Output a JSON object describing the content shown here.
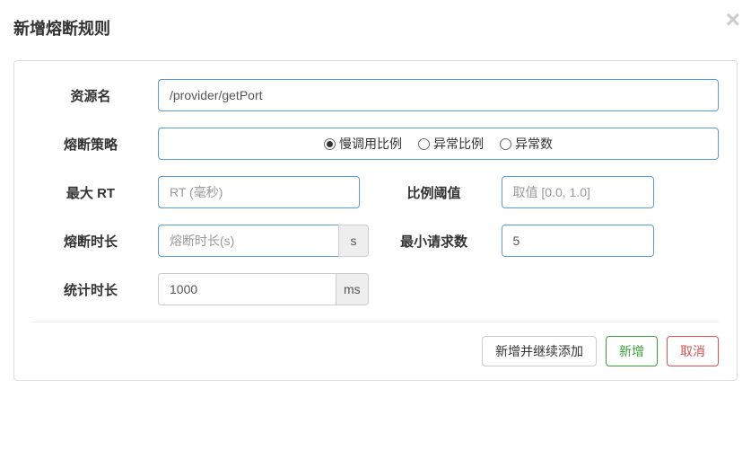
{
  "modal": {
    "title": "新增熔断规则"
  },
  "form": {
    "resource": {
      "label": "资源名",
      "value": "/provider/getPort"
    },
    "strategy": {
      "label": "熔断策略",
      "options": {
        "slow": "慢调用比例",
        "errorRatio": "异常比例",
        "errorCount": "异常数"
      },
      "selected": "slow"
    },
    "maxRt": {
      "label": "最大 RT",
      "placeholder": "RT (毫秒)",
      "value": ""
    },
    "threshold": {
      "label": "比例阈值",
      "placeholder": "取值 [0.0, 1.0]",
      "value": ""
    },
    "timeWindow": {
      "label": "熔断时长",
      "placeholder": "熔断时长(s)",
      "value": "",
      "unit": "s"
    },
    "minRequest": {
      "label": "最小请求数",
      "value": "5"
    },
    "statInterval": {
      "label": "统计时长",
      "value": "1000",
      "unit": "ms"
    }
  },
  "footer": {
    "addContinue": "新增并继续添加",
    "add": "新增",
    "cancel": "取消"
  }
}
